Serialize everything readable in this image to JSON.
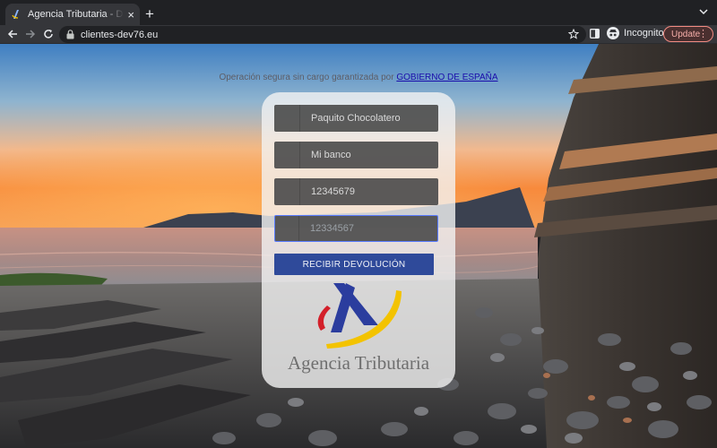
{
  "browser": {
    "tab": {
      "title": "Agencia Tributaria - Devolución",
      "favicon": "agencia-tributaria-favicon"
    },
    "url": "clientes-dev76.eu",
    "profile_label": "Incognito",
    "update_label": "Update",
    "icons": [
      "back-icon",
      "forward-icon",
      "reload-icon",
      "lock-icon",
      "star-icon",
      "side-panel-icon",
      "incognito-icon",
      "menu-dots-icon",
      "new-tab-icon",
      "close-icon",
      "chevron-down-icon"
    ]
  },
  "page": {
    "secure_text": "Operación segura sin cargo garantizada por",
    "secure_link": "GOBIERNO DE ESPAÑA",
    "fields": [
      {
        "value": "Paquito Chocolatero"
      },
      {
        "value": "Mi banco"
      },
      {
        "value": "12345679"
      },
      {
        "value": "12334567"
      }
    ],
    "submit_label": "RECIBIR DEVOLUCIÓN",
    "agency_name": "Agencia Tributaria",
    "colors": {
      "logo_blue": "#2b3d9e",
      "logo_red": "#d3202a",
      "logo_yellow": "#f3c300",
      "button": "#2f4a9a",
      "link": "#1a0dab"
    }
  }
}
